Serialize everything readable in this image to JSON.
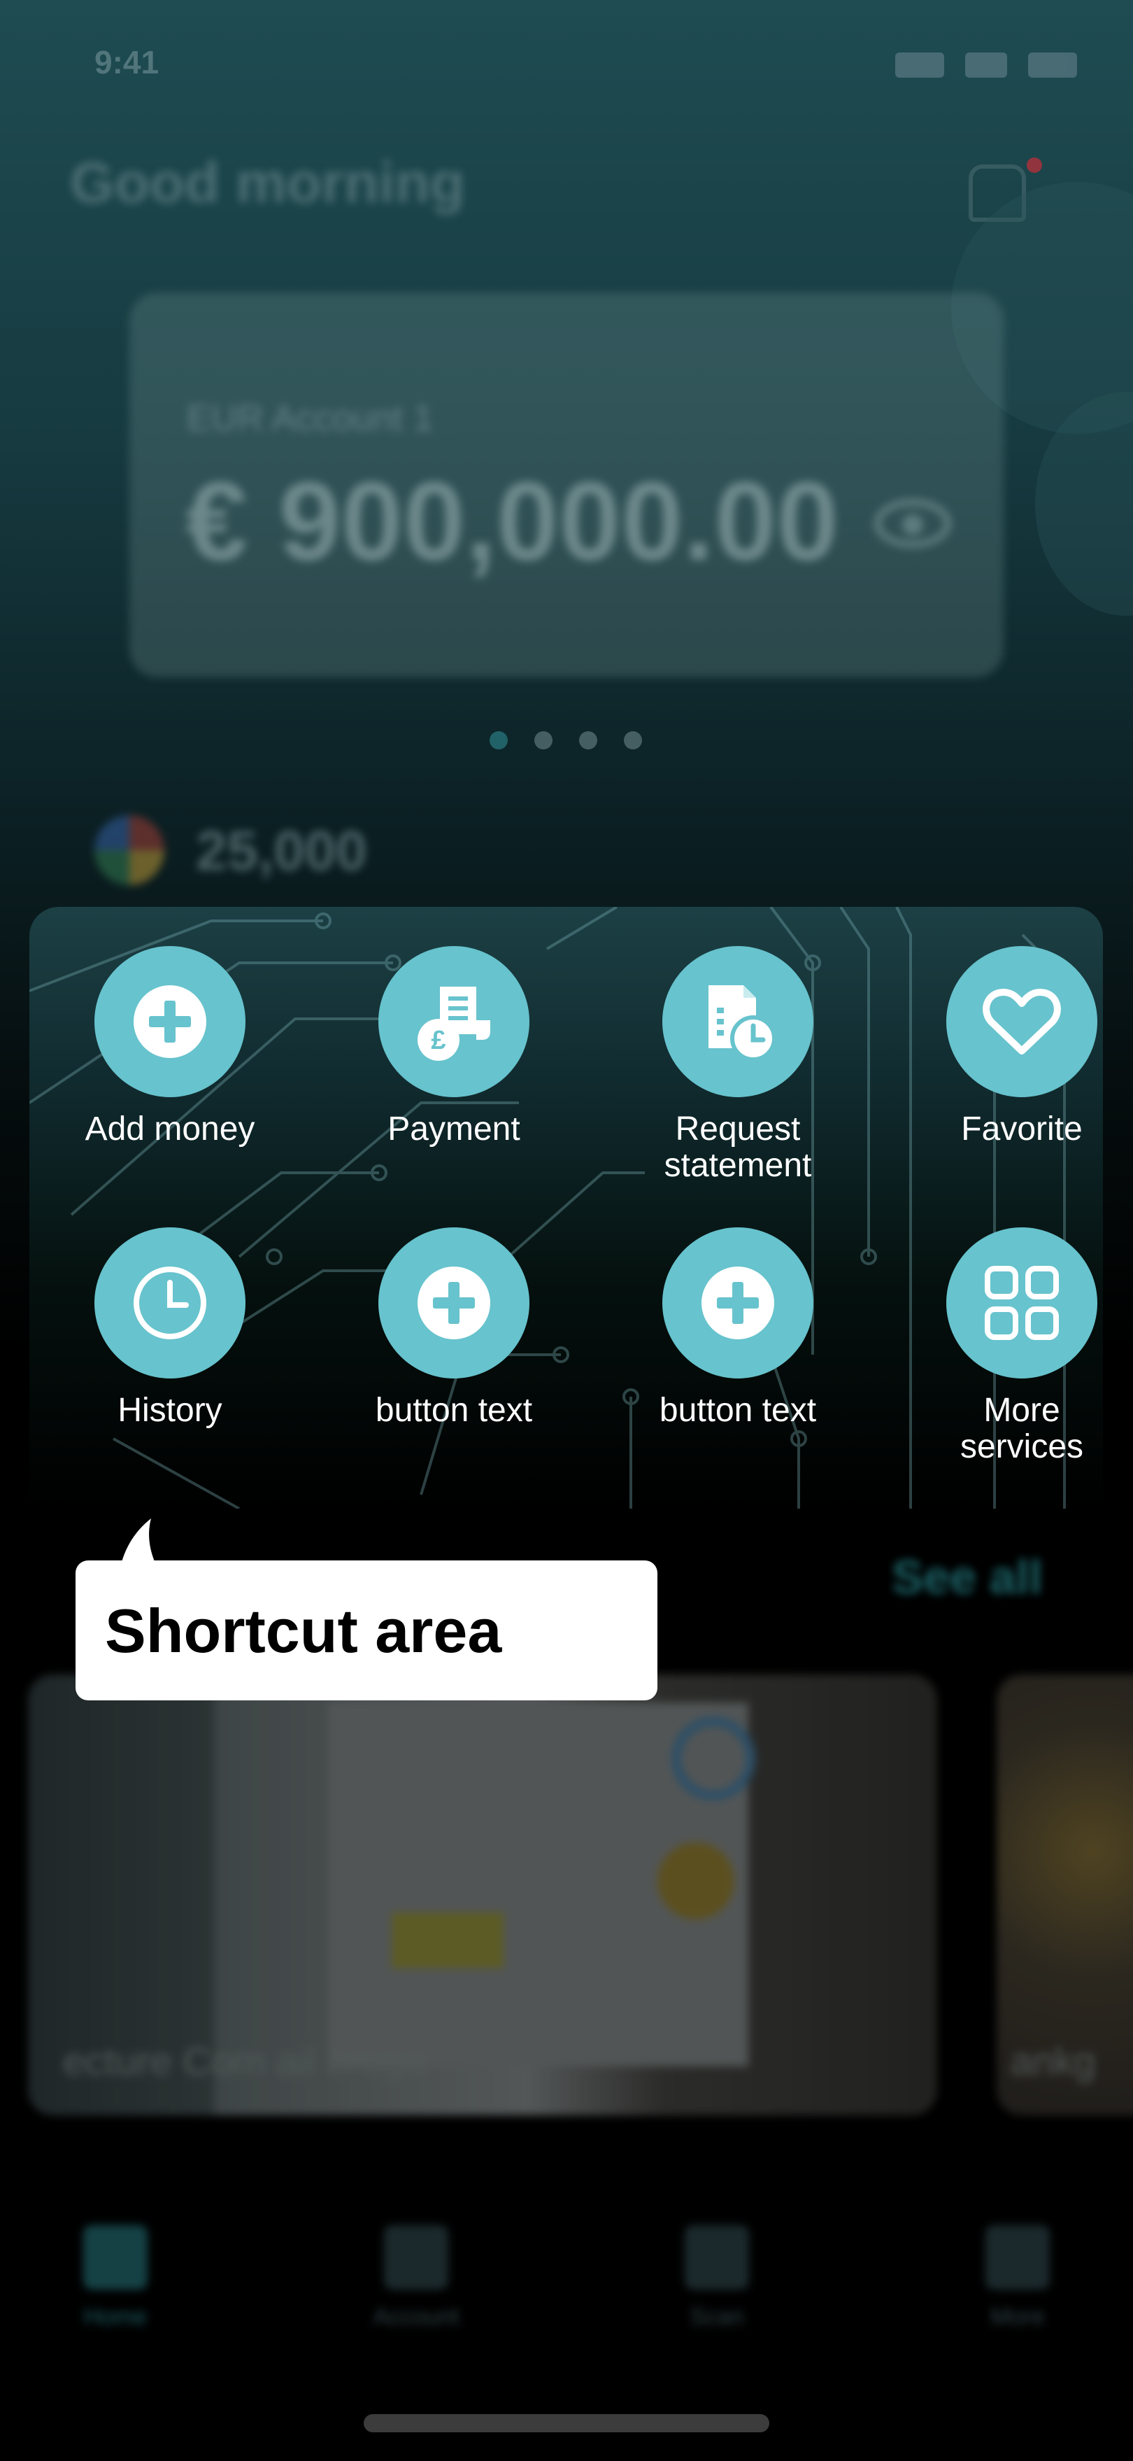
{
  "status_bar": {
    "time": "9:41"
  },
  "header": {
    "greeting": "Good morning"
  },
  "account_card": {
    "label": "EUR Account 1",
    "balance": "€ 900,000.00",
    "pager": {
      "count": 4,
      "active": 1
    }
  },
  "points": {
    "value": "25,000"
  },
  "shortcuts": [
    {
      "label": "Add money",
      "icon": "plus-circle-icon"
    },
    {
      "label": "Payment",
      "icon": "payment-receipt-icon"
    },
    {
      "label": "Request\nstatement",
      "icon": "statement-clock-icon"
    },
    {
      "label": "Favorite",
      "icon": "heart-icon"
    },
    {
      "label": "History",
      "icon": "clock-icon"
    },
    {
      "label": "button text",
      "icon": "plus-circle-icon"
    },
    {
      "label": "button text",
      "icon": "plus-circle-icon"
    },
    {
      "label": "More\nservices",
      "icon": "grid-icon"
    }
  ],
  "section": {
    "see_all": "See all"
  },
  "promos": [
    {
      "caption": "ecture Com ail broga"
    },
    {
      "caption": "ankg"
    }
  ],
  "tabbar": {
    "items": [
      {
        "label": "Home",
        "icon": "home-icon",
        "active": true
      },
      {
        "label": "Account",
        "icon": "wallet-icon",
        "active": false
      },
      {
        "label": "Scan",
        "icon": "scan-icon",
        "active": false
      },
      {
        "label": "More",
        "icon": "menu-icon",
        "active": false
      }
    ]
  },
  "tooltip": {
    "text": "Shortcut area"
  },
  "colors": {
    "accent": "#67c3cd",
    "panel_top": "#1c4045",
    "background": "#000000",
    "tooltip_bg": "#ffffff"
  }
}
